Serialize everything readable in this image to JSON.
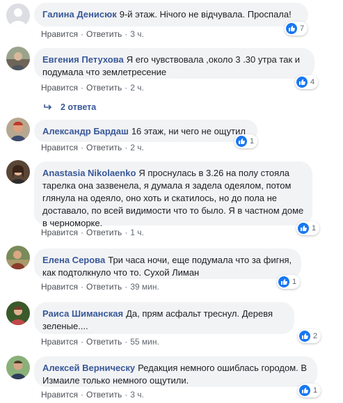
{
  "comments": [
    {
      "author": "Галина Денисюк",
      "text": "9-й этаж. Нічого не відчувала. Проспала!",
      "like": "Нравится",
      "reply": "Ответить",
      "time": "3 ч.",
      "reactions": "7"
    },
    {
      "author": "Евгения Петухова",
      "text": "Я его чувствовала ,около 3 .30 утра так и подумала что землетресение",
      "like": "Нравится",
      "reply": "Ответить",
      "time": "2 ч.",
      "reactions": "4"
    },
    {
      "author": "Александр Бардаш",
      "text": "16 этаж, ни чего не ощутил",
      "like": "Нравится",
      "reply": "Ответить",
      "time": "2 ч.",
      "reactions": "1"
    },
    {
      "author": "Anastasia Nikolaenko",
      "text": "Я проснулась в 3.26 на полу стояла тарелка она зазвенела, я думала я задела одеялом, потом глянула на одеяло, оно хоть и скатилось, но до пола не доставало, по всей видимости что то было. Я в частном доме в черноморке.",
      "like": "Нравится",
      "reply": "Ответить",
      "time": "1 ч.",
      "reactions": "1"
    },
    {
      "author": "Елена Серова",
      "text": "Три часа ночи, еще подумала что за фигня, как подтолкнуло что то. Сухой Лиман",
      "like": "Нравится",
      "reply": "Ответить",
      "time": "39 мин.",
      "reactions": "1"
    },
    {
      "author": "Раиса Шиманская",
      "text": "Да, прям асфальт треснул. Деревя зеленые....",
      "like": "Нравится",
      "reply": "Ответить",
      "time": "55 мин.",
      "reactions": "2"
    },
    {
      "author": "Алексей Верническу",
      "text": "Редакция немного ошиблась городом. В Измаиле только немного ощутили.",
      "like": "Нравится",
      "reply": "Ответить",
      "time": "3 ч.",
      "reactions": "1"
    }
  ],
  "replies_label": "2 ответа",
  "separator": "·",
  "colors": {
    "author": "#385898",
    "bubble": "#f2f3f5",
    "like_icon": "#1877f2"
  },
  "icons": {
    "reaction": "like-thumb-icon",
    "replies": "reply-arrow-icon"
  }
}
